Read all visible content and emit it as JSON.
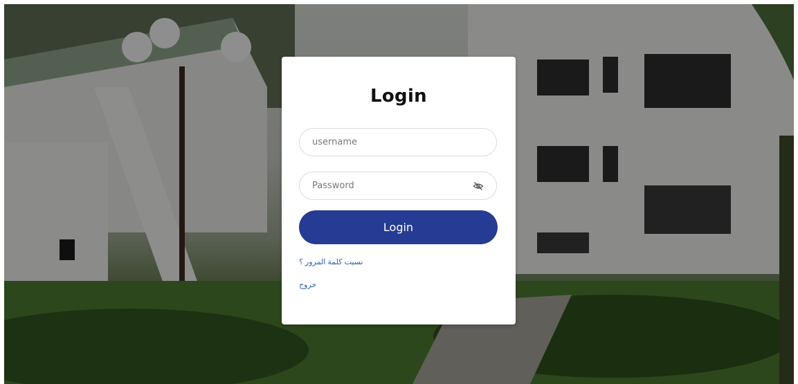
{
  "login": {
    "title": "Login",
    "username_placeholder": "username",
    "password_placeholder": "Password",
    "submit_label": "Login",
    "forgot_password_link": "نسيت كلمة المرور ؟",
    "logout_link": "خروج"
  },
  "icons": {
    "password_toggle": "eye-slash-icon"
  },
  "colors": {
    "primary": "#253b94",
    "link": "#2f5fb3",
    "card": "#ffffff"
  }
}
